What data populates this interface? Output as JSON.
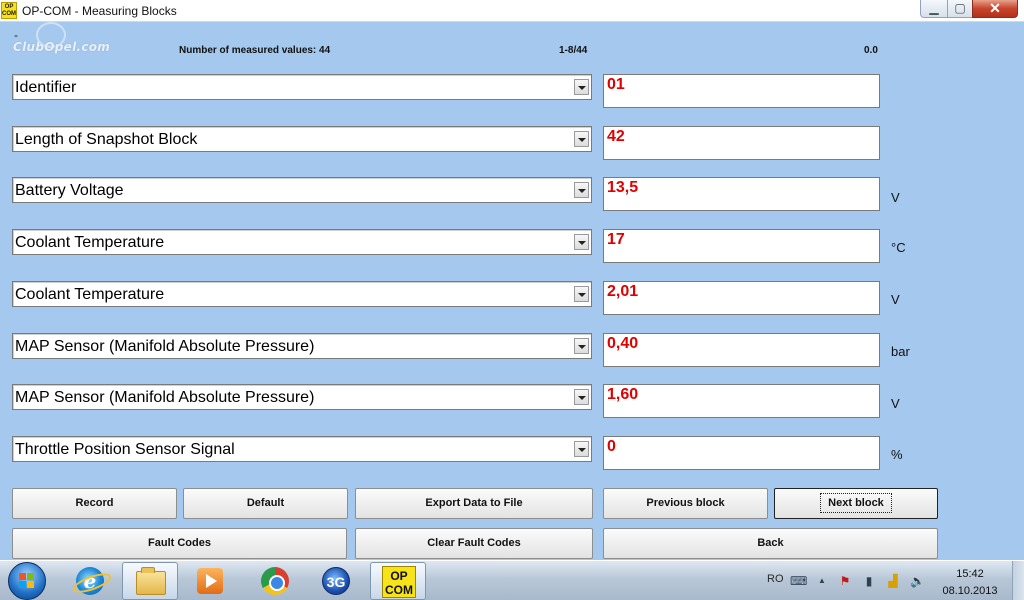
{
  "window": {
    "title": "OP-COM - Measuring Blocks",
    "app_icon_text": "OP COM",
    "minimize_glyph": "▁",
    "maximize_glyph": "▢",
    "close_glyph": "✕"
  },
  "header": {
    "dash": "-",
    "logo": "ClubOpel.com",
    "measured_count": "Number of measured values: 44",
    "range": "1-8/44",
    "value": "0.0"
  },
  "rows": [
    {
      "label": "Identifier",
      "value": "01",
      "unit": ""
    },
    {
      "label": "Length of Snapshot Block",
      "value": "42",
      "unit": ""
    },
    {
      "label": "Battery Voltage",
      "value": "13,5",
      "unit": "V"
    },
    {
      "label": "Coolant Temperature",
      "value": "17",
      "unit": "°C"
    },
    {
      "label": "Coolant Temperature",
      "value": "2,01",
      "unit": "V"
    },
    {
      "label": "MAP Sensor (Manifold Absolute Pressure)",
      "value": "0,40",
      "unit": "bar"
    },
    {
      "label": "MAP Sensor (Manifold Absolute Pressure)",
      "value": "1,60",
      "unit": "V"
    },
    {
      "label": "Throttle Position Sensor Signal",
      "value": "0",
      "unit": "%"
    }
  ],
  "buttons": {
    "record": "Record",
    "default": "Default",
    "export": "Export Data to File",
    "previous": "Previous block",
    "next": "Next block",
    "fault_codes": "Fault Codes",
    "clear_fault_codes": "Clear Fault Codes",
    "back": "Back"
  },
  "taskbar": {
    "ie_glyph": "e",
    "g3_label": "3G",
    "opcom_label_1": "OP",
    "opcom_label_2": "COM",
    "lang": "RO",
    "time": "15:42",
    "date": "08.10.2013"
  },
  "tray_glyphs": {
    "keyboard": "⌨",
    "arrow": "▲",
    "flag": "⚑",
    "battery": "▮",
    "signal": "▟",
    "volume": "🔈"
  }
}
